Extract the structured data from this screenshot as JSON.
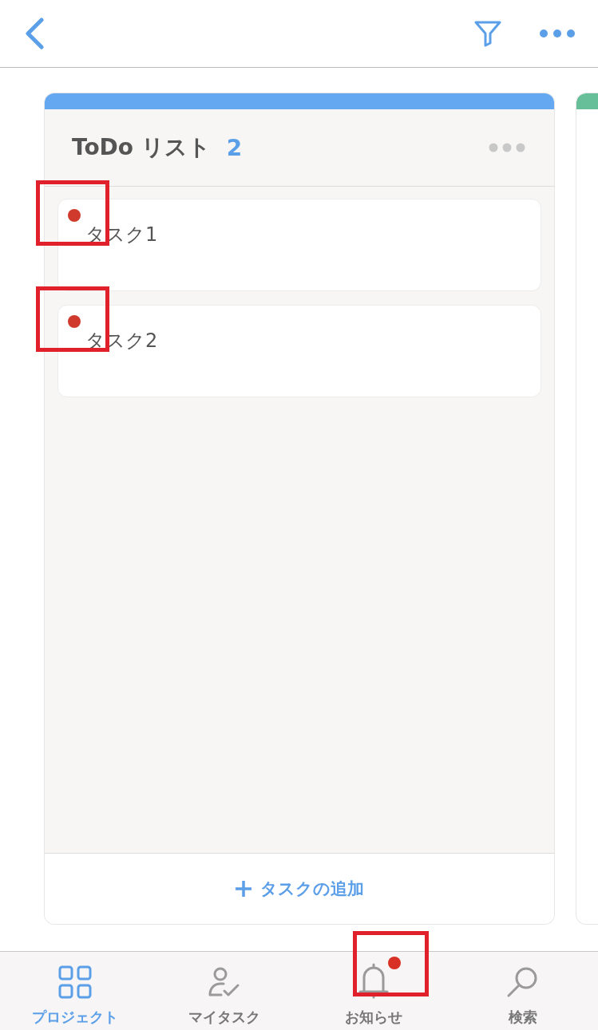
{
  "columns": [
    {
      "color": "#64a8f2",
      "title": "ToDo リスト",
      "count": "2",
      "tasks": [
        {
          "title": "タスク1",
          "highlighted": true
        },
        {
          "title": "タスク2",
          "highlighted": true
        }
      ],
      "add_label": "タスクの追加"
    },
    {
      "color": "#66bf99"
    }
  ],
  "tab_bar": [
    {
      "label": "プロジェクト",
      "selected": true,
      "badge": false,
      "highlighted": false
    },
    {
      "label": "マイタスク",
      "selected": false,
      "badge": false,
      "highlighted": false
    },
    {
      "label": "お知らせ",
      "selected": false,
      "badge": true,
      "highlighted": true
    },
    {
      "label": "検索",
      "selected": false,
      "badge": false,
      "highlighted": false
    }
  ]
}
